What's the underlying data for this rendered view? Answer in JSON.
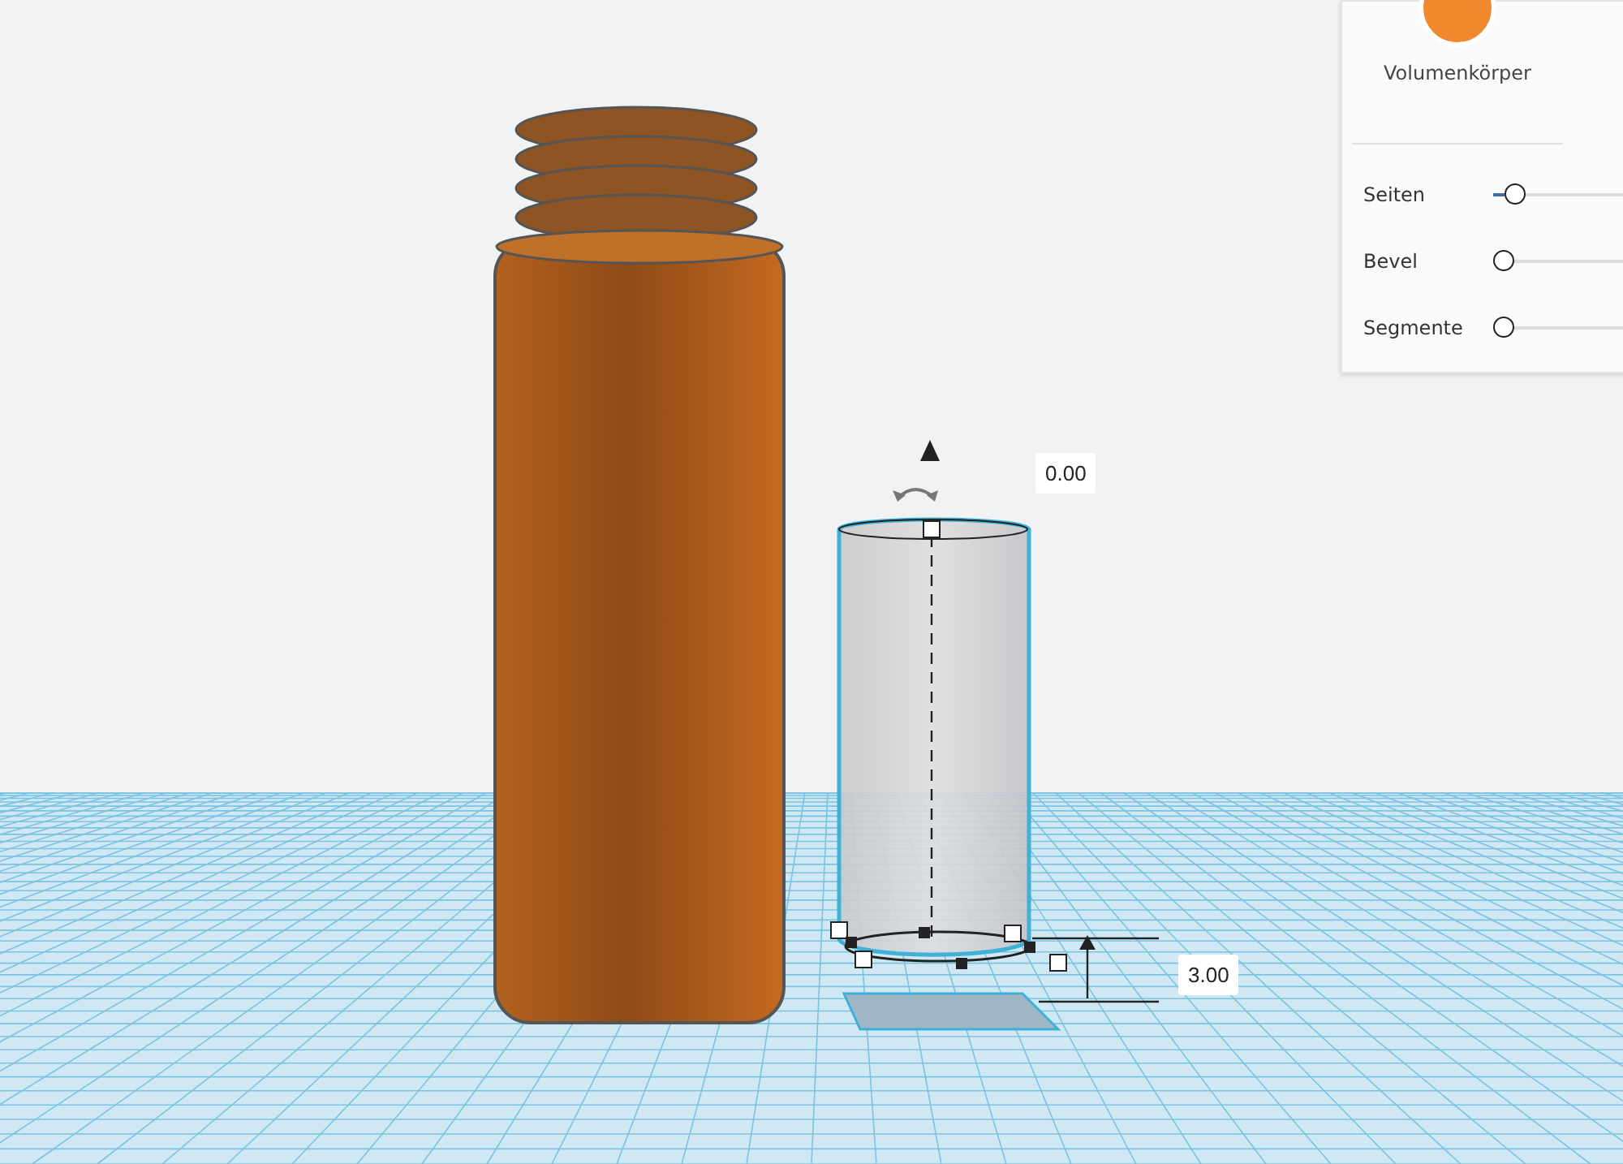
{
  "inspector": {
    "solid_label": "Volumenkörper",
    "sliders": [
      {
        "label": "Seiten",
        "level": 0.1
      },
      {
        "label": "Bevel",
        "level": 0
      },
      {
        "label": "Segmente",
        "level": 0
      }
    ]
  },
  "dimensions": {
    "top_value": "0.00",
    "height_value": "3.00"
  }
}
